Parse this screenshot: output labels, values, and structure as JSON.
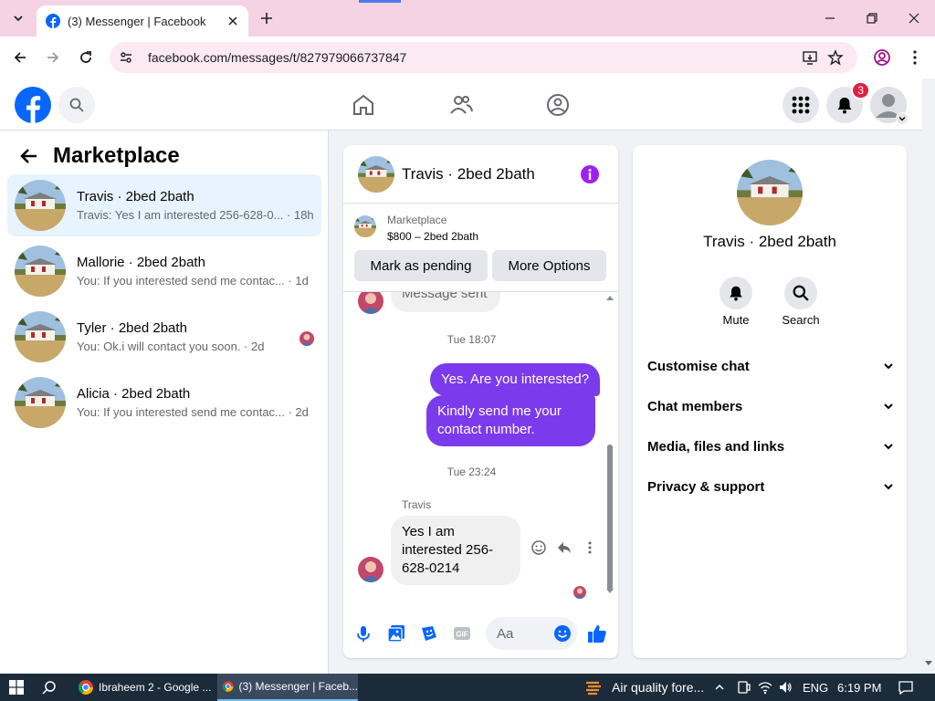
{
  "browser": {
    "tab_title": "(3) Messenger | Facebook",
    "url": "facebook.com/messages/t/827979066737847"
  },
  "fb_header": {
    "notification_count": "3"
  },
  "left_panel": {
    "title": "Marketplace",
    "conversations": [
      {
        "name": "Travis · 2bed 2bath",
        "snippet": "Travis: Yes I am interested 256-628-0... · 18h"
      },
      {
        "name": "Mallorie · 2bed 2bath",
        "snippet": "You: If you interested send me contac... · 1d"
      },
      {
        "name": "Tyler · 2bed 2bath",
        "snippet": "You: Ok.i will contact you soon. · 2d"
      },
      {
        "name": "Alicia · 2bed 2bath",
        "snippet": "You: If you interested send me contac... · 2d"
      }
    ]
  },
  "chat": {
    "title": "Travis · 2bed 2bath",
    "marketplace_label": "Marketplace",
    "listing": "$800 – 2bed 2bath",
    "mark_pending_label": "Mark as pending",
    "more_options_label": "More Options",
    "partial_message": "Message sent",
    "time_1": "Tue 18:07",
    "out_msg_1": "Yes. Are you interested?",
    "out_msg_2": "Kindly send me your contact number.",
    "time_2": "Tue 23:24",
    "sender": "Travis",
    "in_msg": "Yes I am interested 256-628-0214",
    "composer_placeholder": "Aa"
  },
  "info": {
    "name": "Travis · 2bed 2bath",
    "mute_label": "Mute",
    "search_label": "Search",
    "sections": [
      "Customise chat",
      "Chat members",
      "Media, files and links",
      "Privacy & support"
    ]
  },
  "taskbar": {
    "app1": "Ibraheem 2 - Google ...",
    "app2": "(3) Messenger | Faceb...",
    "weather": "Air quality fore...",
    "lang": "ENG",
    "time": "6:19 PM"
  },
  "colors": {
    "fb_blue": "#0866ff",
    "messenger_purple": "#7c3aed",
    "tab_strip": "#f6d3e4"
  }
}
